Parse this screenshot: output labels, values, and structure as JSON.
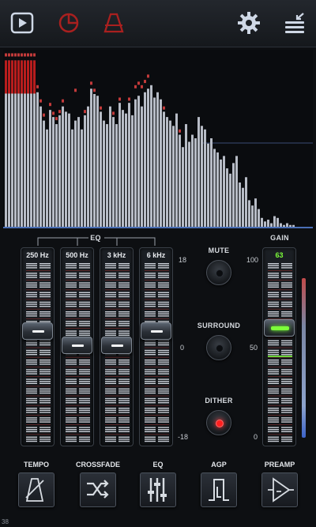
{
  "toolbar": {
    "icons": [
      "play-icon",
      "timer-icon",
      "metronome-icon",
      "gear-icon",
      "menu-icon"
    ],
    "colors": {
      "active": "#cfd8e6",
      "inactive_red": "#a9201f"
    }
  },
  "spectrum": {
    "bars": [
      0.94,
      0.94,
      0.94,
      0.94,
      0.94,
      0.94,
      0.94,
      0.94,
      0.94,
      0.94,
      0.76,
      0.68,
      0.6,
      0.55,
      0.66,
      0.62,
      0.58,
      0.63,
      0.68,
      0.65,
      0.64,
      0.55,
      0.6,
      0.62,
      0.55,
      0.63,
      0.68,
      0.78,
      0.75,
      0.74,
      0.65,
      0.6,
      0.58,
      0.68,
      0.62,
      0.58,
      0.7,
      0.66,
      0.64,
      0.7,
      0.63,
      0.72,
      0.74,
      0.68,
      0.76,
      0.78,
      0.8,
      0.73,
      0.76,
      0.72,
      0.65,
      0.62,
      0.6,
      0.57,
      0.64,
      0.52,
      0.45,
      0.58,
      0.48,
      0.52,
      0.5,
      0.62,
      0.57,
      0.55,
      0.47,
      0.5,
      0.44,
      0.42,
      0.38,
      0.4,
      0.33,
      0.3,
      0.36,
      0.4,
      0.25,
      0.22,
      0.28,
      0.15,
      0.12,
      0.16,
      0.1,
      0.05,
      0.03,
      0.04,
      0.02,
      0.06,
      0.05,
      0.02,
      0.01,
      0.02,
      0.01,
      0.01
    ],
    "peaks": [
      0.98,
      0.98,
      0.98,
      0.98,
      0.98,
      0.98,
      0.98,
      0.98,
      0.98,
      0.98,
      0.8,
      0.72,
      0.64,
      0.58,
      0.7,
      0.65,
      0.62,
      0.66,
      0.72,
      0.67,
      0.66,
      0.58,
      0.78,
      0.64,
      0.58,
      0.66,
      0.7,
      0.82,
      0.78,
      0.76,
      0.68,
      0.62,
      0.6,
      0.7,
      0.65,
      0.6,
      0.73,
      0.68,
      0.66,
      0.73,
      0.65,
      0.8,
      0.82,
      0.8,
      0.83,
      0.86,
      0.8,
      0.75,
      0.78,
      0.74,
      0.68,
      0.64,
      0.62,
      0.59,
      0.66,
      0.55,
      0.48,
      0.6,
      0.5,
      0.54,
      0.52,
      0.64,
      0.59,
      0.57,
      0.49,
      0.52,
      0.46,
      0.44,
      0.4,
      0.42,
      0.35,
      0.32,
      0.38,
      0.42,
      0.27,
      0.24,
      0.3,
      0.17,
      0.14,
      0.18,
      0.12,
      0.07,
      0.05,
      0.06,
      0.04,
      0.08,
      0.07,
      0.04,
      0.03,
      0.04,
      0.03,
      0.03
    ],
    "colors": {
      "bar": "#b7bcc6",
      "clip": "#b81d1d",
      "peak": "#c23a3a",
      "baseline": "#4a6fb5"
    }
  },
  "eq": {
    "title": "EQ",
    "scale": {
      "top": "18",
      "mid": "0",
      "bottom": "-18"
    },
    "bands": [
      {
        "label": "250 Hz",
        "level": 0.17
      },
      {
        "label": "500 Hz",
        "level": 0.02
      },
      {
        "label": "3 kHz",
        "level": 0.02
      },
      {
        "label": "6 kHz",
        "level": 0.17
      }
    ]
  },
  "switches": {
    "mute": {
      "label": "MUTE",
      "on": false
    },
    "surround": {
      "label": "SURROUND",
      "on": false
    },
    "dither": {
      "label": "DITHER",
      "on": true
    }
  },
  "gain": {
    "title": "GAIN",
    "value": "63",
    "level": 0.63,
    "scale": {
      "top": "100",
      "mid": "50",
      "bottom": "0"
    },
    "value_color": "#7dff3a"
  },
  "bottom_buttons": [
    {
      "label": "TEMPO",
      "icon": "metronome-icon"
    },
    {
      "label": "CROSSFADE",
      "icon": "shuffle-icon"
    },
    {
      "label": "EQ",
      "icon": "eq-sliders-icon"
    },
    {
      "label": "AGP",
      "icon": "agp-icon"
    },
    {
      "label": "PREAMP",
      "icon": "amplifier-icon"
    }
  ],
  "footer": {
    "counter": "38"
  }
}
